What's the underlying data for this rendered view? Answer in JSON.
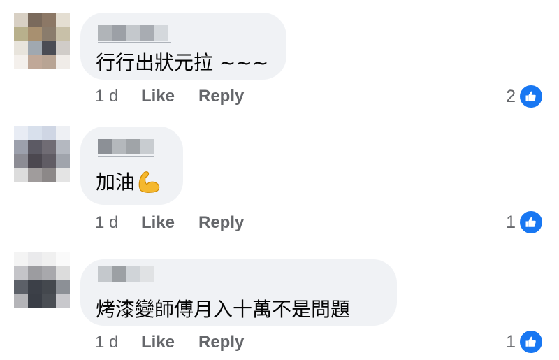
{
  "comments": [
    {
      "text": "行行出狀元拉 ~~~",
      "time": "1 d",
      "like_label": "Like",
      "reply_label": "Reply",
      "reaction_count": "2"
    },
    {
      "text": "加油",
      "emoji": "flexed-biceps",
      "time": "1 d",
      "like_label": "Like",
      "reply_label": "Reply",
      "reaction_count": "1"
    },
    {
      "text": "烤漆變師傅月入十萬不是問題",
      "time": "1 d",
      "like_label": "Like",
      "reply_label": "Reply",
      "reaction_count": "1"
    }
  ],
  "icons": {
    "reaction": "thumbs-up-icon"
  },
  "colors": {
    "bubble": "#f0f2f5",
    "meta_text": "#65676b",
    "like_blue": "#1877f2",
    "text": "#050505"
  }
}
